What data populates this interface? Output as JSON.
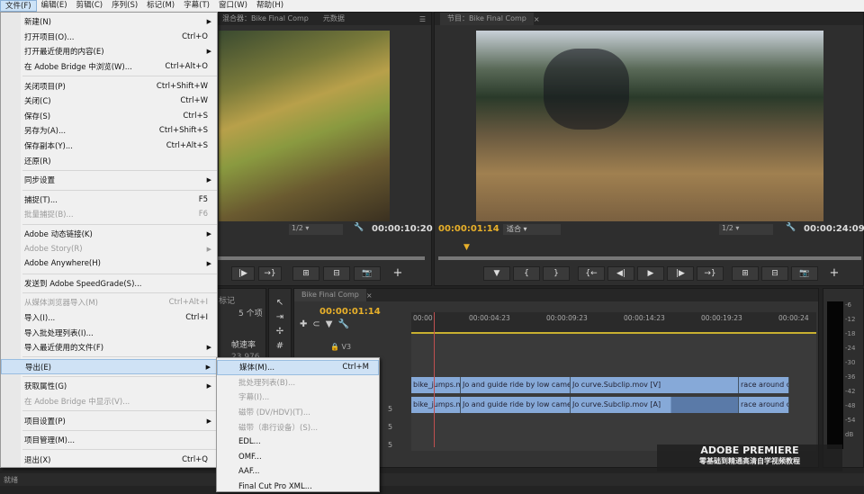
{
  "menubar": [
    "文件(F)",
    "编辑(E)",
    "剪辑(C)",
    "序列(S)",
    "标记(M)",
    "字幕(T)",
    "窗口(W)",
    "帮助(H)"
  ],
  "file_menu": [
    {
      "label": "新建(N)",
      "sub": true
    },
    {
      "label": "打开项目(O)...",
      "shortcut": "Ctrl+O"
    },
    {
      "label": "打开最近使用的内容(E)",
      "sub": true
    },
    {
      "label": "在 Adobe Bridge 中浏览(W)...",
      "shortcut": "Ctrl+Alt+O"
    },
    {
      "sep": true
    },
    {
      "label": "关闭项目(P)",
      "shortcut": "Ctrl+Shift+W"
    },
    {
      "label": "关闭(C)",
      "shortcut": "Ctrl+W"
    },
    {
      "label": "保存(S)",
      "shortcut": "Ctrl+S"
    },
    {
      "label": "另存为(A)...",
      "shortcut": "Ctrl+Shift+S"
    },
    {
      "label": "保存副本(Y)...",
      "shortcut": "Ctrl+Alt+S"
    },
    {
      "label": "还原(R)"
    },
    {
      "sep": true
    },
    {
      "label": "同步设置",
      "sub": true
    },
    {
      "sep": true
    },
    {
      "label": "捕捉(T)...",
      "shortcut": "F5"
    },
    {
      "label": "批量捕捉(B)...",
      "shortcut": "F6",
      "disabled": true
    },
    {
      "sep": true
    },
    {
      "label": "Adobe 动态链接(K)",
      "sub": true
    },
    {
      "label": "Adobe Story(R)",
      "sub": true,
      "disabled": true
    },
    {
      "label": "Adobe Anywhere(H)",
      "sub": true
    },
    {
      "sep": true
    },
    {
      "label": "发送到 Adobe SpeedGrade(S)..."
    },
    {
      "sep": true
    },
    {
      "label": "从媒体浏览器导入(M)",
      "shortcut": "Ctrl+Alt+I",
      "disabled": true
    },
    {
      "label": "导入(I)...",
      "shortcut": "Ctrl+I"
    },
    {
      "label": "导入批处理列表(I)..."
    },
    {
      "label": "导入最近使用的文件(F)",
      "sub": true
    },
    {
      "sep": true
    },
    {
      "label": "导出(E)",
      "sub": true,
      "highlighted": true
    },
    {
      "sep": true
    },
    {
      "label": "获取属性(G)",
      "sub": true
    },
    {
      "label": "在 Adobe Bridge 中显示(V)...",
      "disabled": true
    },
    {
      "sep": true
    },
    {
      "label": "项目设置(P)",
      "sub": true
    },
    {
      "sep": true
    },
    {
      "label": "项目管理(M)..."
    },
    {
      "sep": true
    },
    {
      "label": "退出(X)",
      "shortcut": "Ctrl+Q"
    }
  ],
  "export_menu": [
    {
      "label": "媒体(M)...",
      "shortcut": "Ctrl+M",
      "highlighted": true
    },
    {
      "label": "批处理列表(B)...",
      "disabled": true
    },
    {
      "label": "字幕(I)...",
      "disabled": true
    },
    {
      "label": "磁带 (DV/HDV)(T)...",
      "disabled": true
    },
    {
      "label": "磁带（串行设备）(S)...",
      "disabled": true
    },
    {
      "label": "EDL..."
    },
    {
      "label": "OMF..."
    },
    {
      "label": "AAF..."
    },
    {
      "label": "Final Cut Pro XML..."
    }
  ],
  "source": {
    "tab": "混合器：Bike Final Comp",
    "tab2": "元数据",
    "zoom": "1/2",
    "timecode": "00:00:10:20"
  },
  "program": {
    "tab": "节目：Bike Final Comp",
    "timecode": "00:00:01:14",
    "fit": "适合",
    "zoom": "1/2",
    "duration": "00:00:24:09"
  },
  "project": {
    "tab": "标记",
    "count": "5 个项",
    "col": "帧速率",
    "val": "23.976"
  },
  "timeline": {
    "tab": "Bike Final Comp",
    "timecode": "00:00:01:14",
    "ruler": [
      "00:00",
      "00:00:04:23",
      "00:00:09:23",
      "00:00:14:23",
      "00:00:19:23",
      "00:00:24"
    ],
    "track_v3": "V3",
    "video_clips": [
      "bike_jumps.mov",
      "Jo and guide ride by low camera",
      "Jo curve.Subclip.mov [V]",
      "race around c"
    ],
    "audio_clips": [
      "bike_jumps.mov",
      "Jo and guide ride by low camera",
      "Jo curve.Subclip.mov [A]",
      "race around c"
    ],
    "track_nums": [
      "5",
      "5",
      "5"
    ]
  },
  "meter": {
    "labels": [
      "-6",
      "-12",
      "-18",
      "-24",
      "-30",
      "-36",
      "-42",
      "-48",
      "-54",
      "dB"
    ]
  },
  "watermark": {
    "title": "ADOBE PREMIERE",
    "subtitle": "零基础到精通高清自学视频教程"
  },
  "status": "就绪"
}
